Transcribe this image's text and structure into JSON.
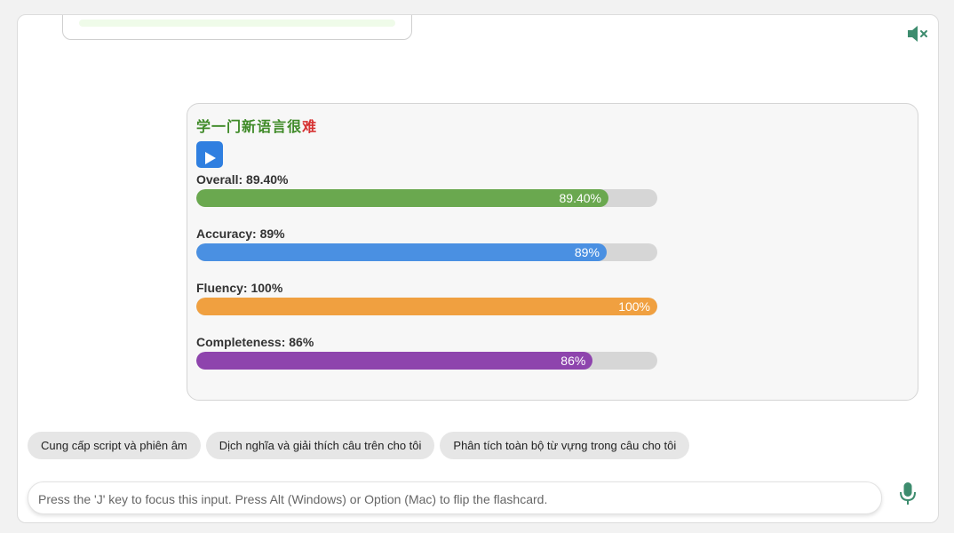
{
  "previous_card": {},
  "audio": {
    "mute_icon": "speaker-mute-icon"
  },
  "result": {
    "sentence": [
      {
        "char": "学",
        "status": "ok"
      },
      {
        "char": "一",
        "status": "ok"
      },
      {
        "char": "门",
        "status": "ok"
      },
      {
        "char": "新",
        "status": "ok"
      },
      {
        "char": "语",
        "status": "ok"
      },
      {
        "char": "言",
        "status": "ok"
      },
      {
        "char": "很",
        "status": "ok"
      },
      {
        "char": "难",
        "status": "bad"
      }
    ],
    "play_icon": "play-icon",
    "metrics": [
      {
        "label": "Overall: 89.40%",
        "value_text": "89.40%",
        "value": 89.4,
        "color": "#6aa84f"
      },
      {
        "label": "Accuracy: 89%",
        "value_text": "89%",
        "value": 89,
        "color": "#4a90e2"
      },
      {
        "label": "Fluency: 100%",
        "value_text": "100%",
        "value": 100,
        "color": "#f0a040"
      },
      {
        "label": "Completeness: 86%",
        "value_text": "86%",
        "value": 86,
        "color": "#8e44ad"
      }
    ]
  },
  "suggestions": [
    "Cung cấp script và phiên âm",
    "Dịch nghĩa và giải thích câu trên cho tôi",
    "Phân tích toàn bộ từ vựng trong câu cho tôi"
  ],
  "input": {
    "value": "",
    "placeholder": "Press the 'J' key to focus this input. Press Alt (Windows) or Option (Mac) to flip the flashcard."
  },
  "mic_icon": "microphone-icon",
  "colors": {
    "ok": "#3f8a28",
    "bad": "#d63333",
    "accent": "#2f7fe0",
    "mic": "#3d8c6e"
  }
}
